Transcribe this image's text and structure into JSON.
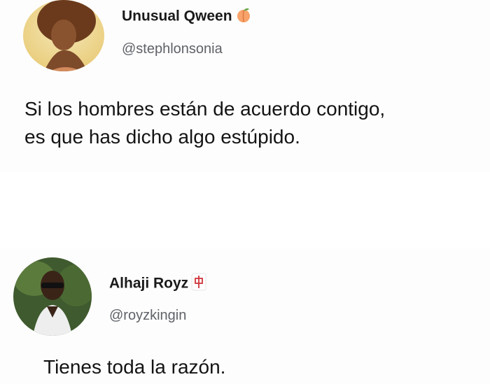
{
  "tweets": [
    {
      "user": {
        "display_name": "Unusual Qween",
        "handle": "@stephlonsonia",
        "name_emoji": "peach-icon"
      },
      "text_lines": [
        "Si los hombres están de acuerdo contigo,",
        "es que has dicho algo estúpido."
      ]
    },
    {
      "user": {
        "display_name": "Alhaji Royz",
        "handle": "@royzkingin",
        "name_emoji": "mahjong-red-dragon-icon"
      },
      "text_lines": [
        "Tienes toda la razón."
      ]
    }
  ],
  "colors": {
    "background": "#fdfdfd",
    "name": "#1a1a1a",
    "handle": "#5f6268",
    "text": "#141414",
    "peach": "#f7a36a",
    "dragon": "#d0343a"
  }
}
